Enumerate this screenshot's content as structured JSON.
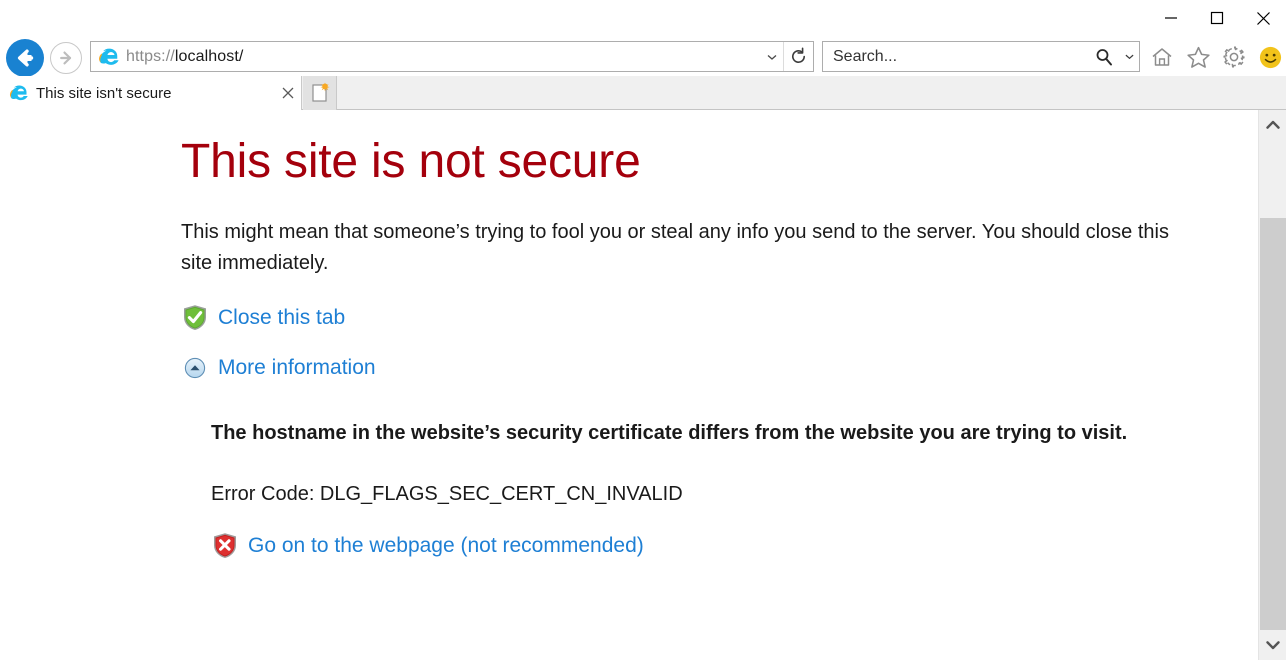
{
  "window": {
    "minimize_label": "Minimize",
    "maximize_label": "Maximize",
    "close_label": "Close"
  },
  "toolbar": {
    "back_label": "Back",
    "forward_label": "Forward",
    "address_scheme": "https://",
    "address_host": "localhost/",
    "address_full": "https://localhost/",
    "address_dropdown_label": "Address dropdown",
    "refresh_label": "Refresh",
    "search_placeholder": "Search...",
    "search_value": "",
    "search_dropdown_label": "Search provider dropdown",
    "home_label": "Home",
    "favorites_label": "View favorites, feeds, and history",
    "tools_label": "Tools",
    "smiley_label": "Send a smile"
  },
  "tabs": {
    "items": [
      {
        "title": "This site isn't secure",
        "close_label": "Close tab"
      }
    ],
    "new_tab_label": "New tab"
  },
  "page": {
    "heading": "This site is not secure",
    "body": "This might mean that someone’s trying to fool you or steal any info you send to the server. You should close this site immediately.",
    "close_tab_link": "Close this tab",
    "more_information_link": "More information",
    "detail_title": "The hostname in the website’s security certificate differs from the website you are trying to visit.",
    "error_code": "Error Code: DLG_FLAGS_SEC_CERT_CN_INVALID",
    "go_on_link": "Go on to the webpage (not recommended)"
  },
  "colors": {
    "heading_red": "#a4000c",
    "link_blue": "#1e7fd4",
    "shield_green": "#3faa3f",
    "shield_red": "#d42525",
    "back_button_blue": "#1982d1"
  },
  "scrollbar": {
    "up_label": "Scroll up",
    "down_label": "Scroll down",
    "thumb_label": "Scroll thumb"
  }
}
